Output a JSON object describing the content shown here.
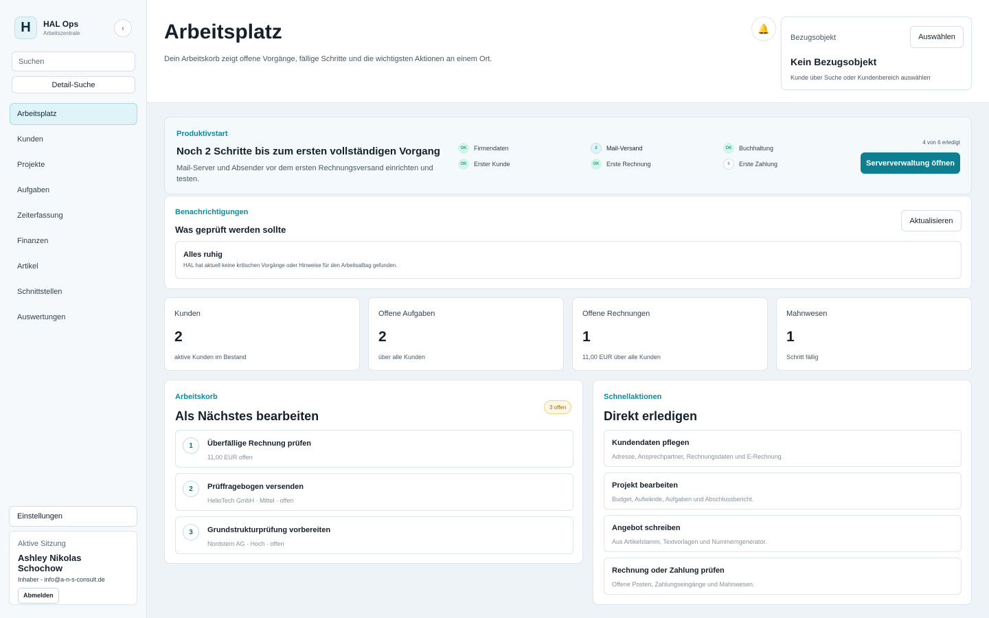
{
  "app": {
    "name": "HAL Ops",
    "subtitle": "Arbeitszentrale",
    "logo_letter": "H",
    "collapse_label": "‹"
  },
  "sidebar": {
    "search_placeholder": "Suchen",
    "detail_search_label": "Detail-Suche",
    "items": [
      {
        "label": "Arbeitsplatz",
        "active": true
      },
      {
        "label": "Kunden"
      },
      {
        "label": "Projekte"
      },
      {
        "label": "Aufgaben"
      },
      {
        "label": "Zeiterfassung"
      },
      {
        "label": "Finanzen"
      },
      {
        "label": "Artikel"
      },
      {
        "label": "Schnittstellen"
      },
      {
        "label": "Auswertungen"
      }
    ],
    "settings_label": "Einstellungen",
    "session": {
      "label": "Aktive Sitzung",
      "name": "Ashley Nikolas Schochow",
      "role": "Inhaber - info@a-n-s-consult.de",
      "logout_label": "Abmelden"
    }
  },
  "header": {
    "title": "Arbeitsplatz",
    "subtitle": "Dein Arbeitskorb zeigt offene Vorgänge, fällige Schritte und die wichtigsten Aktionen an einem Ort.",
    "bell_icon": "bell-icon",
    "reference": {
      "label": "Bezugsobjekt",
      "select_label": "Auswählen",
      "title": "Kein Bezugsobjekt",
      "hint": "Kunde über Suche oder Kundenbereich auswählen"
    }
  },
  "productive_start": {
    "eyebrow": "Produktivstart",
    "title": "Noch 2 Schritte bis zum ersten vollständigen Vorgang",
    "description": "Mail-Server und Absender vor dem ersten Rechnungsversand einrichten und testen.",
    "steps": [
      {
        "badge": "OK",
        "label": "Firmendaten",
        "state": "done"
      },
      {
        "badge": "OK",
        "label": "Erster Kunde",
        "state": "done"
      },
      {
        "badge": "2",
        "label": "Mail-Versand",
        "state": "current"
      },
      {
        "badge": "OK",
        "label": "Erste Rechnung",
        "state": "done"
      },
      {
        "badge": "OK",
        "label": "Buchhaltung",
        "state": "done"
      },
      {
        "badge": "6",
        "label": "Erste Zahlung",
        "state": "pending"
      }
    ],
    "progress_text": "4 von 6 erledigt",
    "action_label": "Serververwaltung öffnen"
  },
  "notifications": {
    "eyebrow": "Benachrichtigungen",
    "title": "Was geprüft werden sollte",
    "refresh_label": "Aktualisieren",
    "status_title": "Alles ruhig",
    "status_text": "HAL hat aktuell keine kritischen Vorgänge oder Hinweise für den Arbeitsalltag gefunden."
  },
  "stats": [
    {
      "label": "Kunden",
      "value": "2",
      "sub": "aktive Kunden im Bestand"
    },
    {
      "label": "Offene Aufgaben",
      "value": "2",
      "sub": "über alle Kunden"
    },
    {
      "label": "Offene Rechnungen",
      "value": "1",
      "sub": "11,00 EUR über alle Kunden"
    },
    {
      "label": "Mahnwesen",
      "value": "1",
      "sub": "Schritt fällig"
    }
  ],
  "workbasket": {
    "eyebrow": "Arbeitskorb",
    "title": "Als Nächstes bearbeiten",
    "badge": "3 offen",
    "items": [
      {
        "num": "1",
        "title": "Überfällige Rechnung prüfen",
        "sub": "11,00 EUR offen"
      },
      {
        "num": "2",
        "title": "Prüffragebogen versenden",
        "sub": "HelioTech GmbH · Mittel · offen"
      },
      {
        "num": "3",
        "title": "Grundstrukturprüfung vorbereiten",
        "sub": "Nordstern AG · Hoch · offen"
      }
    ]
  },
  "quick_actions": {
    "eyebrow": "Schnellaktionen",
    "title": "Direkt erledigen",
    "items": [
      {
        "title": "Kundendaten pflegen",
        "sub": "Adresse, Ansprechpartner, Rechnungsdaten und E-Rechnung."
      },
      {
        "title": "Projekt bearbeiten",
        "sub": "Budget, Aufwände, Aufgaben und Abschlussbericht."
      },
      {
        "title": "Angebot schreiben",
        "sub": "Aus Artikelstamm, Textvorlagen und Nummerngenerator."
      },
      {
        "title": "Rechnung oder Zahlung prüfen",
        "sub": "Offene Posten, Zahlungseingänge und Mahnwesen."
      }
    ]
  }
}
